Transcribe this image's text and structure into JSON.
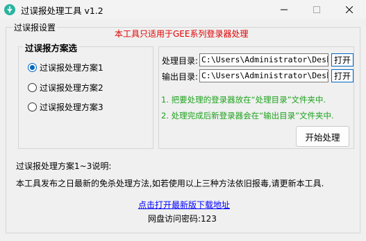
{
  "window": {
    "title": "过误报处理工具 v1.2"
  },
  "settings_group": {
    "label": "过误报设置",
    "notice": "本工具只适用于GEE系列登录器处理"
  },
  "scheme_group": {
    "label": "过误报方案选",
    "options": [
      {
        "label": "过误报处理方案1",
        "checked": true
      },
      {
        "label": "过误报处理方案2",
        "checked": false
      },
      {
        "label": "过误报处理方案3",
        "checked": false
      }
    ]
  },
  "paths": {
    "process_label": "处理目录:",
    "process_value": "C:\\Users\\Administrator\\Desktop",
    "output_label": "输出目录:",
    "output_value": "C:\\Users\\Administrator\\Desktop",
    "open_label": "打开"
  },
  "instructions": [
    "1. 把要处理的登录器放在“处理目录”文件夹中.",
    "2. 处理完成后新登录器会在“输出目录”文件夹中."
  ],
  "start_button": "开始处理",
  "description": {
    "title": "过误报处理方案1~3说明:",
    "body": "本工具发布之日最新的免杀处理方法,如若使用以上三种方法依旧报毒,请更新本工具."
  },
  "download_link": "点击打开最新版下载地址",
  "netdisk_password": "网盘访问密码:123",
  "colors": {
    "accent": "#0067c0",
    "notice_red": "#e00000",
    "instruction_green": "#1ea21e",
    "link_blue": "#0000ff",
    "app_icon": "#2bb3a0"
  }
}
